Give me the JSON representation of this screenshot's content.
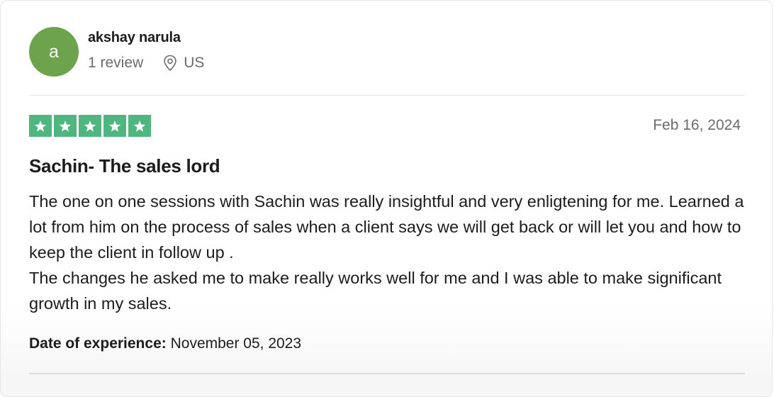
{
  "reviewer": {
    "avatar_initial": "a",
    "avatar_color": "#6da34c",
    "name": "akshay narula",
    "review_count": "1 review",
    "location_icon": "location-pin-icon",
    "country": "US"
  },
  "review": {
    "rating": 5,
    "rating_max": 5,
    "star_color": "#4fb67f",
    "date": "Feb 16, 2024",
    "title": "Sachin- The sales lord",
    "paragraphs": [
      "The one on one sessions with Sachin was really insightful and very enligtening for me. Learned a lot from him on the process of sales when a client says we will get back or will let you and how to keep the client in follow up .",
      "The changes he asked me to make really works well for me and I was able to make significant growth in my sales."
    ],
    "experience_label": "Date of experience:",
    "experience_date": "November 05, 2023"
  }
}
